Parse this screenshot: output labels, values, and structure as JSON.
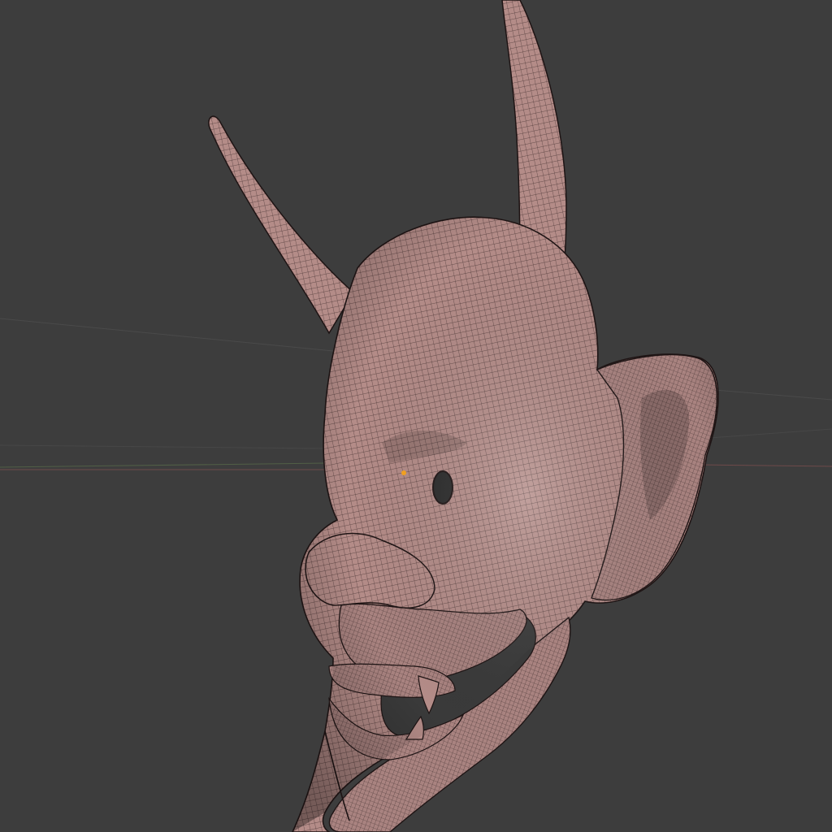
{
  "viewport": {
    "background_color": "#3d3d3d",
    "grid_line_color": "#4a4a4a",
    "axis_x_color": "#6e4a4a",
    "axis_y_color": "#5a6e4a",
    "origin_dot_color": "#f0a020"
  },
  "model": {
    "object_type": "hannya-mask-mesh",
    "shading_mode": "solid-wireframe",
    "surface_color": "#b18a86",
    "shadow_color": "#6f5250",
    "highlight_color": "#cfa8a3",
    "wire_color": "#2a1c1c"
  }
}
